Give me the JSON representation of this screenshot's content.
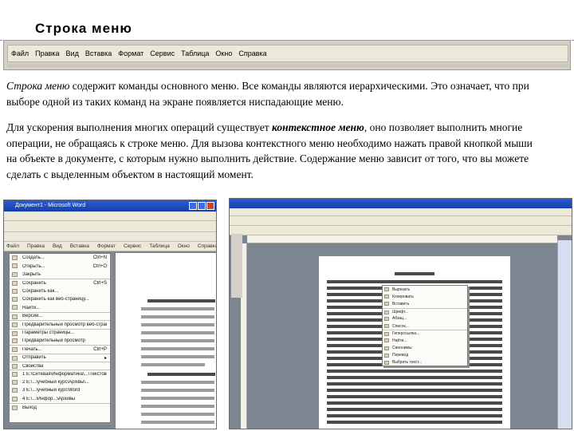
{
  "slide": {
    "title": "Строка меню"
  },
  "menu_strip": {
    "items": [
      "Файл",
      "Правка",
      "Вид",
      "Вставка",
      "Формат",
      "Сервис",
      "Таблица",
      "Окно",
      "Справка"
    ]
  },
  "paragraph1": {
    "term": "Строка меню",
    "text": " содержит команды основного меню. Все команды являются иерархическими. Это означает, что при выборе одной из таких команд на экране появляется ниспадающие меню."
  },
  "paragraph2": {
    "part1": "Для ускорения выполнения многих операций существует ",
    "term": "контекстное меню",
    "part2": ", оно позволяет выполнить многие операции, не обращаясь к строке меню. Для вызова контекстного меню необходимо нажать правой кнопкой мыши на объекте в документе, с которым нужно выполнить действие. Содержание меню зависит от того, что вы можете сделать с выделенным объектом в настоящий момент."
  },
  "screenshot_left": {
    "window_title": "Документ1 - Microsoft Word",
    "menu_items": [
      "Файл",
      "Правка",
      "Вид",
      "Вставка",
      "Формат",
      "Сервис",
      "Таблица",
      "Окно",
      "Справка"
    ],
    "file_menu": [
      {
        "label": "Создать...",
        "shortcut": "Ctrl+N"
      },
      {
        "label": "Открыть...",
        "shortcut": "Ctrl+O"
      },
      {
        "label": "Закрыть",
        "shortcut": ""
      },
      {
        "label": "Сохранить",
        "shortcut": "Ctrl+S"
      },
      {
        "label": "Сохранить как...",
        "shortcut": ""
      },
      {
        "label": "Сохранить как веб-страницу...",
        "shortcut": ""
      },
      {
        "label": "Найти...",
        "shortcut": ""
      },
      {
        "label": "Версии...",
        "shortcut": ""
      },
      {
        "label": "Предварительный просмотр веб-страницы",
        "shortcut": ""
      },
      {
        "label": "Параметры страницы...",
        "shortcut": ""
      },
      {
        "label": "Предварительный просмотр",
        "shortcut": ""
      },
      {
        "label": "Печать...",
        "shortcut": "Ctrl+P"
      },
      {
        "label": "Отправить",
        "shortcut": "▸"
      },
      {
        "label": "Свойства",
        "shortcut": ""
      },
      {
        "label": "1 E:\\Сетевая\\Информатика\\...\\Текстовые",
        "shortcut": ""
      },
      {
        "label": "2 E:\\...\\учебный курс\\Аpixвы\\...",
        "shortcut": ""
      },
      {
        "label": "3 E:\\...\\учебный курс\\Word",
        "shortcut": ""
      },
      {
        "label": "4 E:\\...\\Инфор...\\Аpxивы",
        "shortcut": ""
      },
      {
        "label": "Выход",
        "shortcut": ""
      }
    ]
  },
  "screenshot_right": {
    "context_menu": [
      "Вырезать",
      "Копировать",
      "Вставить",
      "Шрифт...",
      "Абзац...",
      "Список...",
      "Гиперссылка...",
      "Найти...",
      "Синонимы",
      "Перевод",
      "Выбрать текст..."
    ]
  }
}
